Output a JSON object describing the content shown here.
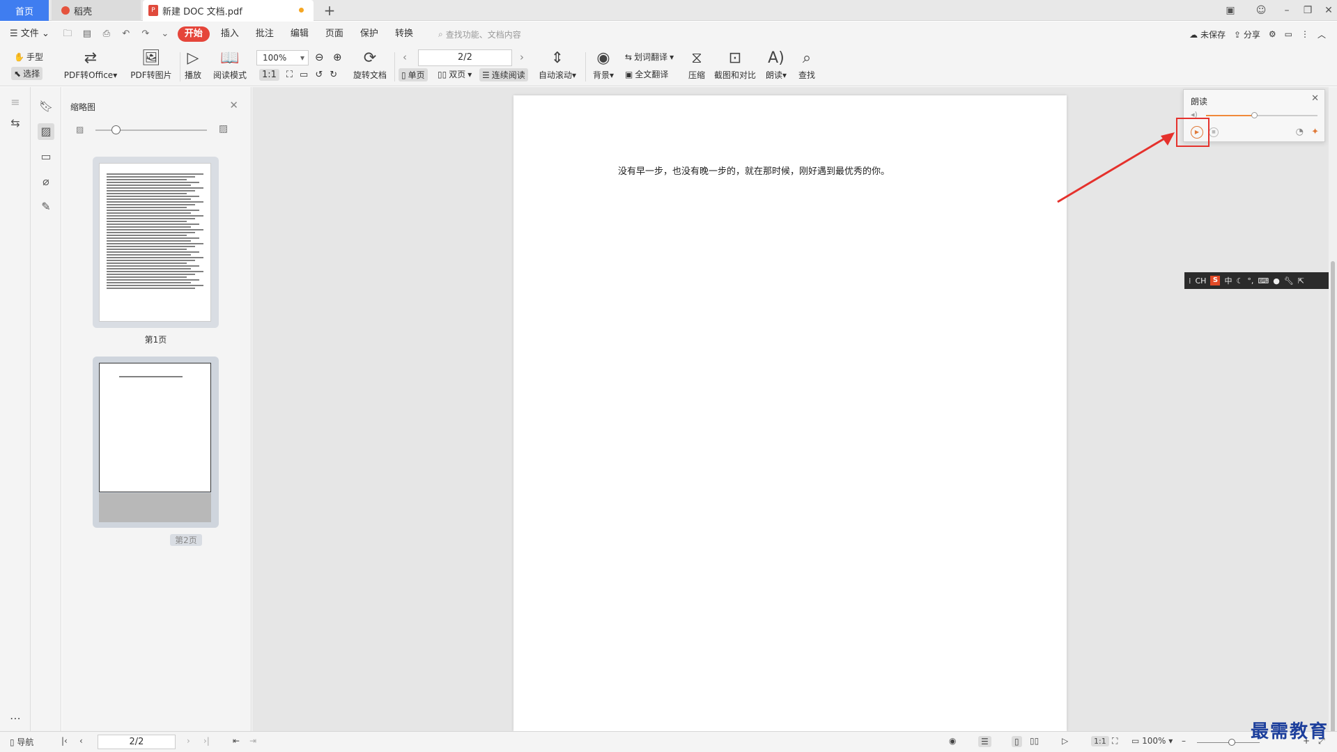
{
  "tabs": {
    "home": "首页",
    "daoke": "稻壳",
    "doc": "新建 DOC 文档.pdf"
  },
  "menu": {
    "file": "文件",
    "items": [
      "开始",
      "插入",
      "批注",
      "编辑",
      "页面",
      "保护",
      "转换"
    ],
    "search_placeholder": "查找功能、文档内容",
    "unsaved": "未保存",
    "share": "分享"
  },
  "ribbon": {
    "hand": "手型",
    "select": "选择",
    "pdf_to_office": "PDF转Office",
    "pdf_to_image": "PDF转图片",
    "play": "播放",
    "read_mode": "阅读模式",
    "zoom": "100%",
    "rotate_doc": "旋转文档",
    "page_value": "2/2",
    "single_page": "单页",
    "double_page": "双页",
    "continuous": "连续阅读",
    "auto_scroll": "自动滚动",
    "background": "背景",
    "word_translate": "划词翻译",
    "full_translate": "全文翻译",
    "compress": "压缩",
    "screenshot_compare": "截图和对比",
    "read_aloud": "朗读",
    "find": "查找"
  },
  "thumbnail_panel": {
    "title": "缩略图",
    "page1_label": "第1页",
    "page2_label": "第2页"
  },
  "document": {
    "text": "没有早一步，也没有晚一步的，就在那时候，刚好遇到最优秀的你。"
  },
  "read_panel": {
    "title": "朗读",
    "volume": 0.43
  },
  "ime": {
    "label": "CH",
    "mode": "中"
  },
  "statusbar": {
    "nav": "导航",
    "page_value": "2/2",
    "zoom": "100%",
    "zoom_level": 0.55
  },
  "watermark": "最需教育",
  "colors": {
    "accent": "#3f7df0",
    "start_button": "#e5453a",
    "highlight": "#e5312c",
    "read_accent": "#f0893a"
  }
}
